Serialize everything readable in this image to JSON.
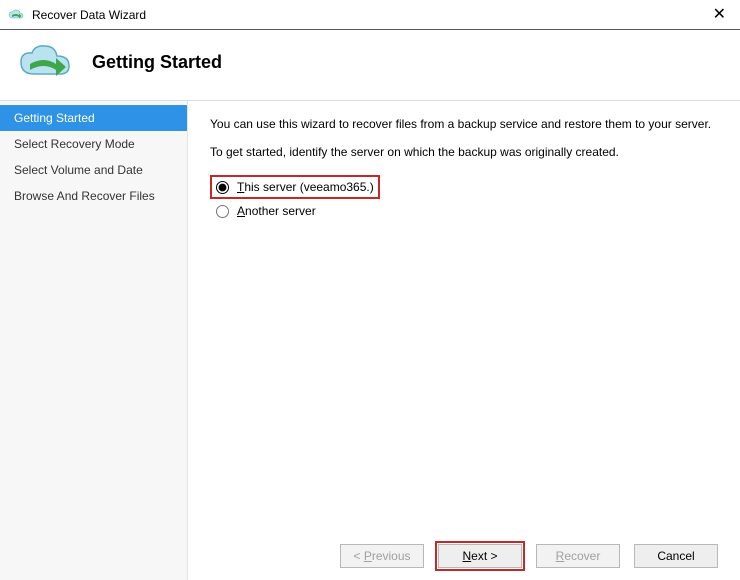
{
  "window": {
    "title": "Recover Data Wizard"
  },
  "header": {
    "title": "Getting Started"
  },
  "sidebar": {
    "items": [
      {
        "label": "Getting Started",
        "active": true
      },
      {
        "label": "Select Recovery Mode",
        "active": false
      },
      {
        "label": "Select Volume and Date",
        "active": false
      },
      {
        "label": "Browse And Recover Files",
        "active": false
      }
    ]
  },
  "main": {
    "intro": "You can use this wizard to recover files from a backup service and restore them to your server.",
    "instruction": "To get started, identify the server on which the backup was originally created.",
    "options": [
      {
        "key": "T",
        "rest": "his server (veeamo365.)",
        "selected": true,
        "highlight": true
      },
      {
        "key": "A",
        "rest": "nother server",
        "selected": false,
        "highlight": false
      }
    ]
  },
  "footer": {
    "previous": {
      "key": "P",
      "pre": "< ",
      "rest": "revious",
      "enabled": false,
      "highlight": false
    },
    "next": {
      "key": "N",
      "pre": "",
      "rest": "ext >",
      "enabled": true,
      "highlight": true
    },
    "recover": {
      "key": "R",
      "pre": "",
      "rest": "ecover",
      "enabled": false,
      "highlight": false
    },
    "cancel": {
      "label": "Cancel",
      "enabled": true,
      "highlight": false
    }
  }
}
